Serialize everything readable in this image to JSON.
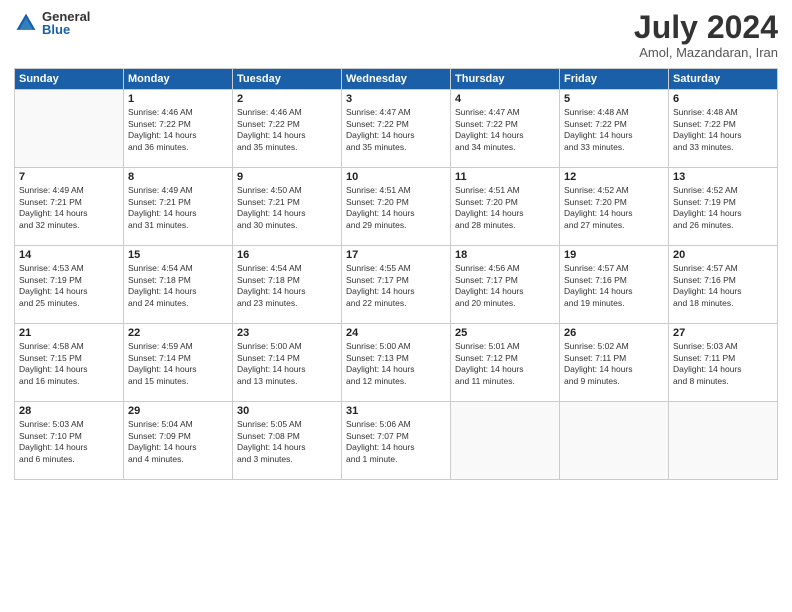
{
  "logo": {
    "general": "General",
    "blue": "Blue"
  },
  "title": "July 2024",
  "subtitle": "Amol, Mazandaran, Iran",
  "days": [
    "Sunday",
    "Monday",
    "Tuesday",
    "Wednesday",
    "Thursday",
    "Friday",
    "Saturday"
  ],
  "weeks": [
    [
      {
        "num": "",
        "lines": []
      },
      {
        "num": "1",
        "lines": [
          "Sunrise: 4:46 AM",
          "Sunset: 7:22 PM",
          "Daylight: 14 hours",
          "and 36 minutes."
        ]
      },
      {
        "num": "2",
        "lines": [
          "Sunrise: 4:46 AM",
          "Sunset: 7:22 PM",
          "Daylight: 14 hours",
          "and 35 minutes."
        ]
      },
      {
        "num": "3",
        "lines": [
          "Sunrise: 4:47 AM",
          "Sunset: 7:22 PM",
          "Daylight: 14 hours",
          "and 35 minutes."
        ]
      },
      {
        "num": "4",
        "lines": [
          "Sunrise: 4:47 AM",
          "Sunset: 7:22 PM",
          "Daylight: 14 hours",
          "and 34 minutes."
        ]
      },
      {
        "num": "5",
        "lines": [
          "Sunrise: 4:48 AM",
          "Sunset: 7:22 PM",
          "Daylight: 14 hours",
          "and 33 minutes."
        ]
      },
      {
        "num": "6",
        "lines": [
          "Sunrise: 4:48 AM",
          "Sunset: 7:22 PM",
          "Daylight: 14 hours",
          "and 33 minutes."
        ]
      }
    ],
    [
      {
        "num": "7",
        "lines": [
          "Sunrise: 4:49 AM",
          "Sunset: 7:21 PM",
          "Daylight: 14 hours",
          "and 32 minutes."
        ]
      },
      {
        "num": "8",
        "lines": [
          "Sunrise: 4:49 AM",
          "Sunset: 7:21 PM",
          "Daylight: 14 hours",
          "and 31 minutes."
        ]
      },
      {
        "num": "9",
        "lines": [
          "Sunrise: 4:50 AM",
          "Sunset: 7:21 PM",
          "Daylight: 14 hours",
          "and 30 minutes."
        ]
      },
      {
        "num": "10",
        "lines": [
          "Sunrise: 4:51 AM",
          "Sunset: 7:20 PM",
          "Daylight: 14 hours",
          "and 29 minutes."
        ]
      },
      {
        "num": "11",
        "lines": [
          "Sunrise: 4:51 AM",
          "Sunset: 7:20 PM",
          "Daylight: 14 hours",
          "and 28 minutes."
        ]
      },
      {
        "num": "12",
        "lines": [
          "Sunrise: 4:52 AM",
          "Sunset: 7:20 PM",
          "Daylight: 14 hours",
          "and 27 minutes."
        ]
      },
      {
        "num": "13",
        "lines": [
          "Sunrise: 4:52 AM",
          "Sunset: 7:19 PM",
          "Daylight: 14 hours",
          "and 26 minutes."
        ]
      }
    ],
    [
      {
        "num": "14",
        "lines": [
          "Sunrise: 4:53 AM",
          "Sunset: 7:19 PM",
          "Daylight: 14 hours",
          "and 25 minutes."
        ]
      },
      {
        "num": "15",
        "lines": [
          "Sunrise: 4:54 AM",
          "Sunset: 7:18 PM",
          "Daylight: 14 hours",
          "and 24 minutes."
        ]
      },
      {
        "num": "16",
        "lines": [
          "Sunrise: 4:54 AM",
          "Sunset: 7:18 PM",
          "Daylight: 14 hours",
          "and 23 minutes."
        ]
      },
      {
        "num": "17",
        "lines": [
          "Sunrise: 4:55 AM",
          "Sunset: 7:17 PM",
          "Daylight: 14 hours",
          "and 22 minutes."
        ]
      },
      {
        "num": "18",
        "lines": [
          "Sunrise: 4:56 AM",
          "Sunset: 7:17 PM",
          "Daylight: 14 hours",
          "and 20 minutes."
        ]
      },
      {
        "num": "19",
        "lines": [
          "Sunrise: 4:57 AM",
          "Sunset: 7:16 PM",
          "Daylight: 14 hours",
          "and 19 minutes."
        ]
      },
      {
        "num": "20",
        "lines": [
          "Sunrise: 4:57 AM",
          "Sunset: 7:16 PM",
          "Daylight: 14 hours",
          "and 18 minutes."
        ]
      }
    ],
    [
      {
        "num": "21",
        "lines": [
          "Sunrise: 4:58 AM",
          "Sunset: 7:15 PM",
          "Daylight: 14 hours",
          "and 16 minutes."
        ]
      },
      {
        "num": "22",
        "lines": [
          "Sunrise: 4:59 AM",
          "Sunset: 7:14 PM",
          "Daylight: 14 hours",
          "and 15 minutes."
        ]
      },
      {
        "num": "23",
        "lines": [
          "Sunrise: 5:00 AM",
          "Sunset: 7:14 PM",
          "Daylight: 14 hours",
          "and 13 minutes."
        ]
      },
      {
        "num": "24",
        "lines": [
          "Sunrise: 5:00 AM",
          "Sunset: 7:13 PM",
          "Daylight: 14 hours",
          "and 12 minutes."
        ]
      },
      {
        "num": "25",
        "lines": [
          "Sunrise: 5:01 AM",
          "Sunset: 7:12 PM",
          "Daylight: 14 hours",
          "and 11 minutes."
        ]
      },
      {
        "num": "26",
        "lines": [
          "Sunrise: 5:02 AM",
          "Sunset: 7:11 PM",
          "Daylight: 14 hours",
          "and 9 minutes."
        ]
      },
      {
        "num": "27",
        "lines": [
          "Sunrise: 5:03 AM",
          "Sunset: 7:11 PM",
          "Daylight: 14 hours",
          "and 8 minutes."
        ]
      }
    ],
    [
      {
        "num": "28",
        "lines": [
          "Sunrise: 5:03 AM",
          "Sunset: 7:10 PM",
          "Daylight: 14 hours",
          "and 6 minutes."
        ]
      },
      {
        "num": "29",
        "lines": [
          "Sunrise: 5:04 AM",
          "Sunset: 7:09 PM",
          "Daylight: 14 hours",
          "and 4 minutes."
        ]
      },
      {
        "num": "30",
        "lines": [
          "Sunrise: 5:05 AM",
          "Sunset: 7:08 PM",
          "Daylight: 14 hours",
          "and 3 minutes."
        ]
      },
      {
        "num": "31",
        "lines": [
          "Sunrise: 5:06 AM",
          "Sunset: 7:07 PM",
          "Daylight: 14 hours",
          "and 1 minute."
        ]
      },
      {
        "num": "",
        "lines": []
      },
      {
        "num": "",
        "lines": []
      },
      {
        "num": "",
        "lines": []
      }
    ]
  ]
}
